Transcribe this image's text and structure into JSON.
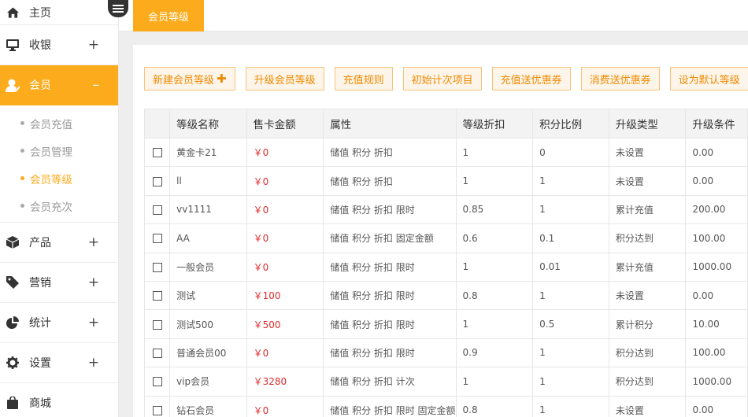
{
  "sidebar": {
    "items": [
      {
        "label": "主页",
        "icon": "home-icon",
        "plus": ""
      },
      {
        "label": "收银",
        "icon": "monitor-icon",
        "plus": "+"
      },
      {
        "label": "会员",
        "icon": "member-icon",
        "plus": "–"
      },
      {
        "label": "产品",
        "icon": "box-icon",
        "plus": "+"
      },
      {
        "label": "营销",
        "icon": "tag-icon",
        "plus": "+"
      },
      {
        "label": "统计",
        "icon": "pie-chart-icon",
        "plus": "+"
      },
      {
        "label": "设置",
        "icon": "gear-icon",
        "plus": "+"
      },
      {
        "label": "商城",
        "icon": "shop-icon",
        "plus": ""
      }
    ],
    "submenu": [
      "会员充值",
      "会员管理",
      "会员等级",
      "会员充次"
    ]
  },
  "tabs": [
    "会员等级"
  ],
  "actions": [
    "新建会员等级",
    "升级会员等级",
    "充值规则",
    "初始计次项目",
    "充值送优惠券",
    "消费送优惠券",
    "设为默认等级"
  ],
  "table": {
    "headers": [
      "等级名称",
      "售卡金额",
      "属性",
      "等级折扣",
      "积分比例",
      "升级类型",
      "升级条件"
    ],
    "rows": [
      [
        "黄金卡21",
        "￥0",
        "储值 积分 折扣",
        "1",
        "0",
        "未设置",
        "0.00"
      ],
      [
        "ll",
        "￥0",
        "储值 积分 折扣",
        "1",
        "1",
        "未设置",
        "0.00"
      ],
      [
        "vv1111",
        "￥0",
        "储值 积分 折扣 限时",
        "0.85",
        "1",
        "累计充值",
        "200.00"
      ],
      [
        "AA",
        "￥0",
        "储值 积分 折扣 固定金额",
        "0.6",
        "0.1",
        "积分达到",
        "100.00"
      ],
      [
        "一般会员",
        "￥0",
        "储值 积分 折扣 限时",
        "1",
        "0.01",
        "累计充值",
        "1000.00"
      ],
      [
        "测试",
        "￥100",
        "储值 积分 折扣 限时",
        "0.8",
        "1",
        "未设置",
        "0.00"
      ],
      [
        "测试500",
        "￥500",
        "储值 积分 折扣 限时",
        "1",
        "0.5",
        "累计积分",
        "10.00"
      ],
      [
        "普通会员00",
        "￥0",
        "储值 积分 折扣 限时",
        "0.9",
        "1",
        "积分达到",
        "100.00"
      ],
      [
        "vip会员",
        "￥3280",
        "储值 积分 折扣 计次",
        "1",
        "1",
        "积分达到",
        "1000.00"
      ],
      [
        "钻石会员",
        "￥0",
        "储值 积分 折扣 限时 固定金额",
        "0.8",
        "1",
        "未设置",
        "0.00"
      ]
    ]
  },
  "colors": {
    "accent": "#fbab1b",
    "price": "#e02b2b"
  }
}
